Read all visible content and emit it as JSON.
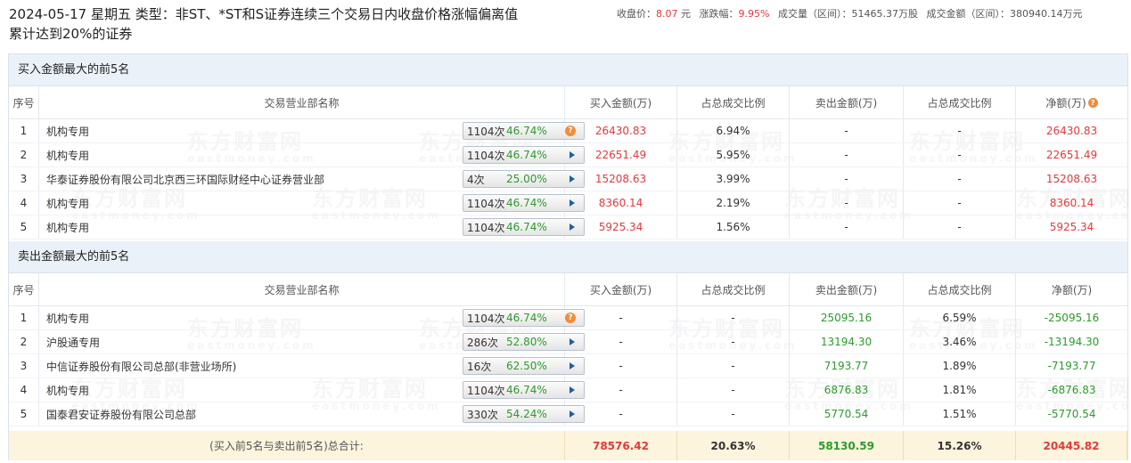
{
  "header": {
    "title_line1": "2024-05-17 星期五 类型：非ST、*ST和S证券连续三个交易日内收盘价格涨幅偏离值",
    "title_line2": "累计达到20%的证券",
    "close_label": "收盘价：",
    "close_value": "8.07",
    "close_unit": "元",
    "change_label": "涨跌幅：",
    "change_value": "9.95%",
    "volume_label": "成交量（区间）：",
    "volume_value": "51465.37万股",
    "amount_label": "成交金额（区间）：",
    "amount_value": "380940.14万元"
  },
  "buy_section": {
    "title": "买入金额最大的前5名",
    "columns": [
      "序号",
      "交易营业部名称",
      "买入金额(万)",
      "占总成交比例",
      "卖出金额(万)",
      "占总成交比例",
      "净额(万)"
    ],
    "rows": [
      {
        "idx": "1",
        "name": "机构专用",
        "count": "1104次",
        "rate": "46.74%",
        "icon": "question-icon",
        "buy": "26430.83",
        "buy_pct": "6.94%",
        "sell": "-",
        "sell_pct": "-",
        "net": "26430.83"
      },
      {
        "idx": "2",
        "name": "机构专用",
        "count": "1104次",
        "rate": "46.74%",
        "icon": "arrow-right-icon",
        "buy": "22651.49",
        "buy_pct": "5.95%",
        "sell": "-",
        "sell_pct": "-",
        "net": "22651.49"
      },
      {
        "idx": "3",
        "name": "华泰证券股份有限公司北京西三环国际财经中心证券营业部",
        "count": "4次",
        "rate": "25.00%",
        "icon": "arrow-right-icon",
        "buy": "15208.63",
        "buy_pct": "3.99%",
        "sell": "-",
        "sell_pct": "-",
        "net": "15208.63"
      },
      {
        "idx": "4",
        "name": "机构专用",
        "count": "1104次",
        "rate": "46.74%",
        "icon": "arrow-right-icon",
        "buy": "8360.14",
        "buy_pct": "2.19%",
        "sell": "-",
        "sell_pct": "-",
        "net": "8360.14"
      },
      {
        "idx": "5",
        "name": "机构专用",
        "count": "1104次",
        "rate": "46.74%",
        "icon": "arrow-right-icon",
        "buy": "5925.34",
        "buy_pct": "1.56%",
        "sell": "-",
        "sell_pct": "-",
        "net": "5925.34"
      }
    ]
  },
  "sell_section": {
    "title": "卖出金额最大的前5名",
    "columns": [
      "序号",
      "交易营业部名称",
      "买入金额(万)",
      "占总成交比例",
      "卖出金额(万)",
      "占总成交比例",
      "净额(万)"
    ],
    "rows": [
      {
        "idx": "1",
        "name": "机构专用",
        "count": "1104次",
        "rate": "46.74%",
        "icon": "question-icon",
        "buy": "-",
        "buy_pct": "-",
        "sell": "25095.16",
        "sell_pct": "6.59%",
        "net": "-25095.16"
      },
      {
        "idx": "2",
        "name": "沪股通专用",
        "count": "286次",
        "rate": "52.80%",
        "icon": "arrow-right-icon",
        "buy": "-",
        "buy_pct": "-",
        "sell": "13194.30",
        "sell_pct": "3.46%",
        "net": "-13194.30"
      },
      {
        "idx": "3",
        "name": "中信证券股份有限公司总部(非营业场所)",
        "count": "16次",
        "rate": "62.50%",
        "icon": "arrow-right-icon",
        "buy": "-",
        "buy_pct": "-",
        "sell": "7193.77",
        "sell_pct": "1.89%",
        "net": "-7193.77"
      },
      {
        "idx": "4",
        "name": "机构专用",
        "count": "1104次",
        "rate": "46.74%",
        "icon": "arrow-right-icon",
        "buy": "-",
        "buy_pct": "-",
        "sell": "6876.83",
        "sell_pct": "1.81%",
        "net": "-6876.83"
      },
      {
        "idx": "5",
        "name": "国泰君安证券股份有限公司总部",
        "count": "330次",
        "rate": "54.24%",
        "icon": "arrow-right-icon",
        "buy": "-",
        "buy_pct": "-",
        "sell": "5770.54",
        "sell_pct": "1.51%",
        "net": "-5770.54"
      }
    ]
  },
  "total": {
    "label": "(买入前5名与卖出前5名)总合计:",
    "buy": "78576.42",
    "buy_pct": "20.63%",
    "sell": "58130.59",
    "sell_pct": "15.26%",
    "net": "20445.82"
  },
  "watermark": {
    "text": "东方财富网",
    "subtext": "eastmoney.com"
  },
  "colors": {
    "positive": "#e4393c",
    "negative": "#2e9a2e",
    "section_bg": "#eaf1f8",
    "total_bg": "#fcf4dc",
    "accent_icon": "#f18c3a"
  }
}
